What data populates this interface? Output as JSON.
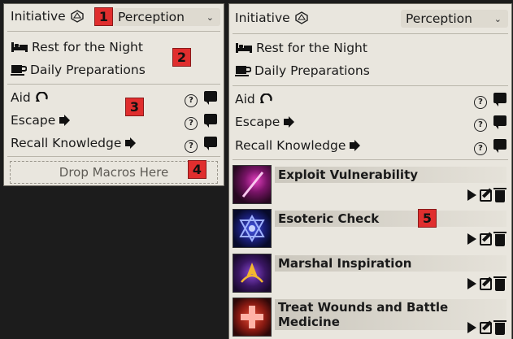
{
  "left": {
    "initiative_label": "Initiative",
    "initiative_value": "Perception",
    "rest_label": "Rest for the Night",
    "prep_label": "Daily Preparations",
    "actions": [
      {
        "label": "Aid"
      },
      {
        "label": "Escape"
      },
      {
        "label": "Recall Knowledge"
      }
    ],
    "drop_label": "Drop Macros Here"
  },
  "right": {
    "initiative_label": "Initiative",
    "initiative_value": "Perception",
    "rest_label": "Rest for the Night",
    "prep_label": "Daily Preparations",
    "actions": [
      {
        "label": "Aid"
      },
      {
        "label": "Escape"
      },
      {
        "label": "Recall Knowledge"
      }
    ],
    "macros": [
      {
        "name": "Exploit Vulnerability",
        "colors": [
          "#3a0d3a",
          "#c2279c"
        ]
      },
      {
        "name": "Esoteric Check",
        "colors": [
          "#0b0f3c",
          "#3d4fd8"
        ]
      },
      {
        "name": "Marshal Inspiration",
        "colors": [
          "#2d0f4a",
          "#e0a020"
        ]
      },
      {
        "name": "Treat Wounds and Battle Medicine",
        "colors": [
          "#3d0a0a",
          "#d43a2a"
        ]
      }
    ]
  },
  "badges": [
    "1",
    "2",
    "3",
    "4",
    "5"
  ]
}
